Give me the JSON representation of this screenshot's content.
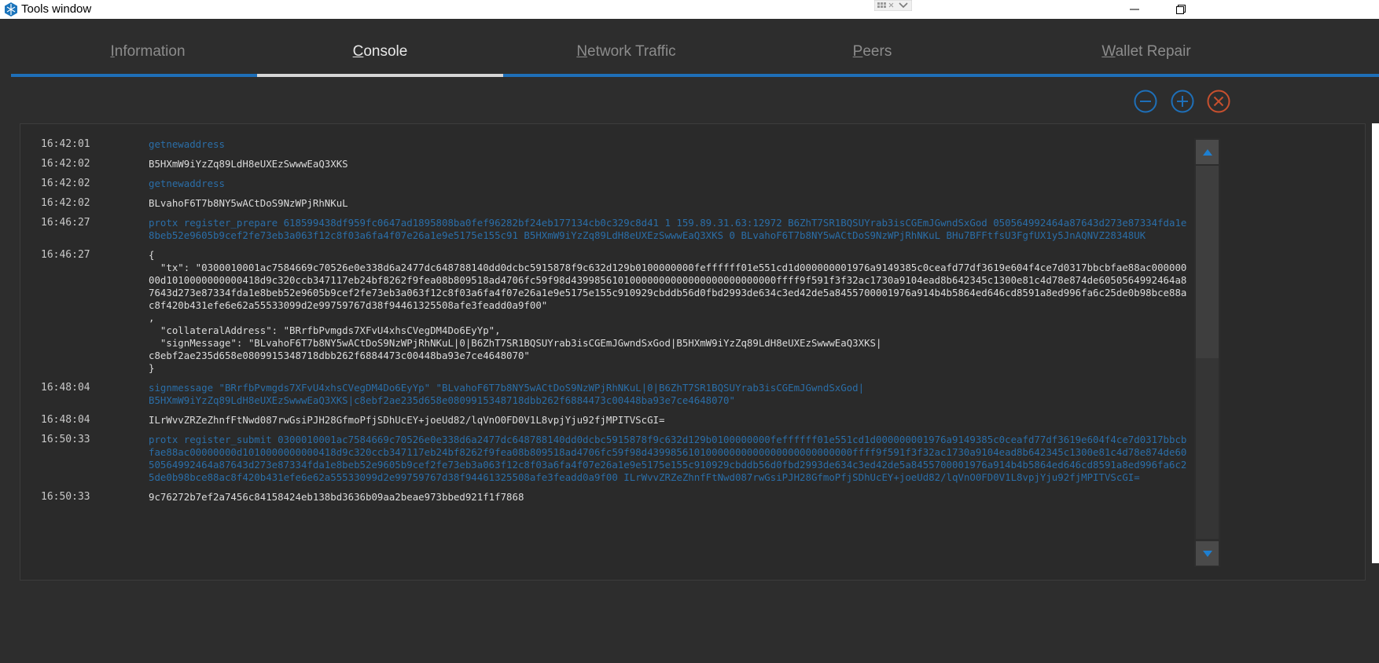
{
  "window": {
    "title": "Tools window",
    "app_icon": "cube-grid-icon",
    "controls": [
      "minimize-icon",
      "restore-icon"
    ]
  },
  "tabs": [
    {
      "label": "Information",
      "accel": "I",
      "rest": "nformation",
      "active": false
    },
    {
      "label": "Console",
      "accel": "C",
      "rest": "onsole",
      "active": true
    },
    {
      "label": "Network Traffic",
      "accel": "N",
      "rest": "etwork Traffic",
      "active": false
    },
    {
      "label": "Peers",
      "accel": "P",
      "rest": "eers",
      "active": false
    },
    {
      "label": "Wallet Repair",
      "accel": "W",
      "rest": "allet Repair",
      "active": false
    }
  ],
  "font_controls": [
    "zoom-out-icon",
    "zoom-in-icon",
    "clear-console-icon"
  ],
  "colors": {
    "accent": "#1e6fb8",
    "command_text": "#2a6ea8",
    "clear_button": "#c8502e",
    "background": "#2d2d2d"
  },
  "console": {
    "lines": [
      {
        "time": "16:42:01",
        "type": "command",
        "text": "getnewaddress"
      },
      {
        "time": "16:42:02",
        "type": "reply",
        "text": "B5HXmW9iYzZq89LdH8eUXEzSwwwEaQ3XKS"
      },
      {
        "time": "16:42:02",
        "type": "command",
        "text": "getnewaddress"
      },
      {
        "time": "16:42:02",
        "type": "reply",
        "text": "BLvahoF6T7b8NY5wACtDoS9NzWPjRhNKuL"
      },
      {
        "time": "16:46:27",
        "type": "command",
        "text": "protx register_prepare 618599438df959fc0647ad1895808ba0fef96282bf24eb177134cb0c329c8d41 1 159.89.31.63:12972 B6ZhT7SR1BQSUYrab3isCGEmJGwndSxGod 050564992464a87643d273e87334fda1e8beb52e9605b9cef2fe73eb3a063f12c8f03a6fa4f07e26a1e9e5175e155c91 B5HXmW9iYzZq89LdH8eUXEzSwwwEaQ3XKS 0 BLvahoF6T7b8NY5wACtDoS9NzWPjRhNKuL BHu7BFFtfsU3FgfUX1y5JnAQNVZ28348UK"
      },
      {
        "time": "16:46:27",
        "type": "reply",
        "text": "{\n  \"tx\": \"0300010001ac7584669c70526e0e338d6a2477dc648788140dd0dcbc5915878f9c632d129b0100000000feffffff01e551cd1d000000001976a9149385c0ceafd77df3619e604f4ce7d0317bbcbfae88ac00000000d1010000000000418d9c320ccb347117eb24bf8262f9fea08b809518ad4706fc59f98d43998561010000000000000000000000000ffff9f591f3f32ac1730a9104ead8b642345c1300e81c4d78e874de6050564992464a87643d273e87334fda1e8beb52e9605b9cef2fe73eb3a063f12c8f03a6fa4f07e26a1e9e5175e155c910929cbddb56d0fbd2993de634c3ed42de5a8455700001976a914b4b5864ed646cd8591a8ed996fa6c25de0b98bce88ac8f420b431efe6e62a55533099d2e99759767d38f94461325508afe3feadd0a9f00\"\n,\n  \"collateralAddress\": \"BRrfbPvmgds7XFvU4xhsCVegDM4Do6EyYp\",\n  \"signMessage\": \"BLvahoF6T7b8NY5wACtDoS9NzWPjRhNKuL|0|B6ZhT7SR1BQSUYrab3isCGEmJGwndSxGod|B5HXmW9iYzZq89LdH8eUXEzSwwwEaQ3XKS|\nc8ebf2ae235d658e0809915348718dbb262f6884473c00448ba93e7ce4648070\"\n}"
      },
      {
        "time": "16:48:04",
        "type": "command",
        "text": "signmessage \"BRrfbPvmgds7XFvU4xhsCVegDM4Do6EyYp\" \"BLvahoF6T7b8NY5wACtDoS9NzWPjRhNKuL|0|B6ZhT7SR1BQSUYrab3isCGEmJGwndSxGod|\nB5HXmW9iYzZq89LdH8eUXEzSwwwEaQ3XKS|c8ebf2ae235d658e0809915348718dbb262f6884473c00448ba93e7ce4648070\""
      },
      {
        "time": "16:48:04",
        "type": "reply",
        "text": "ILrWvvZRZeZhnfFtNwd087rwGsiPJH28GfmoPfjSDhUcEY+joeUd82/lqVnO0FD0V1L8vpjYju92fjMPITVScGI="
      },
      {
        "time": "16:50:33",
        "type": "command",
        "text": "protx register_submit 0300010001ac7584669c70526e0e338d6a2477dc648788140dd0dcbc5915878f9c632d129b0100000000feffffff01e551cd1d000000001976a9149385c0ceafd77df3619e604f4ce7d0317bbcbfae88ac00000000d1010000000000418d9c320ccb347117eb24bf8262f9fea08b809518ad4706fc59f98d43998561010000000000000000000000000ffff9f591f3f32ac1730a9104ead8b642345c1300e81c4d78e874de6050564992464a87643d273e87334fda1e8beb52e9605b9cef2fe73eb3a063f12c8f03a6fa4f07e26a1e9e5175e155c910929cbddb56d0fbd2993de634c3ed42de5a8455700001976a914b4b5864ed646cd8591a8ed996fa6c25de0b98bce88ac8f420b431efe6e62a55533099d2e99759767d38f94461325508afe3feadd0a9f00 ILrWvvZRZeZhnfFtNwd087rwGsiPJH28GfmoPfjSDhUcEY+joeUd82/lqVnO0FD0V1L8vpjYju92fjMPITVScGI="
      },
      {
        "time": "16:50:33",
        "type": "reply",
        "text": "9c76272b7ef2a7456c84158424eb138bd3636b09aa2beae973bbed921f1f7868"
      }
    ]
  }
}
